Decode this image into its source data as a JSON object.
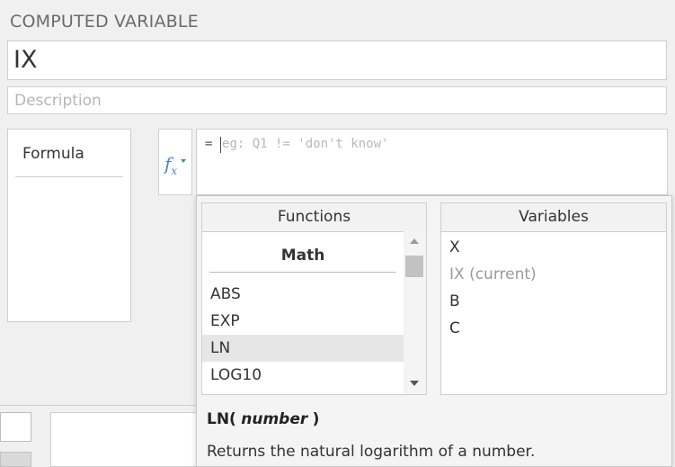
{
  "header": {
    "section_title": "COMPUTED VARIABLE"
  },
  "variable": {
    "name": "IX",
    "description_placeholder": "Description"
  },
  "formula_tab": {
    "label": "Formula"
  },
  "formula": {
    "fx_icon": "function-icon",
    "equals": "=",
    "placeholder": "eg: Q1 != 'don't know'"
  },
  "functions_panel": {
    "title": "Functions",
    "category": "Math",
    "items": [
      {
        "label": "ABS"
      },
      {
        "label": "EXP"
      },
      {
        "label": "LN",
        "selected": true
      },
      {
        "label": "LOG10"
      }
    ]
  },
  "variables_panel": {
    "title": "Variables",
    "items": [
      {
        "label": "X"
      },
      {
        "label": "IX (current)",
        "current": true
      },
      {
        "label": "B"
      },
      {
        "label": "C"
      }
    ]
  },
  "help": {
    "function_name": "LN(",
    "argument": "number",
    "close": ")",
    "description": "Returns the natural logarithm of a number."
  },
  "colors": {
    "accent": "#4c86c5",
    "selected_row": "#e6e6e6"
  }
}
